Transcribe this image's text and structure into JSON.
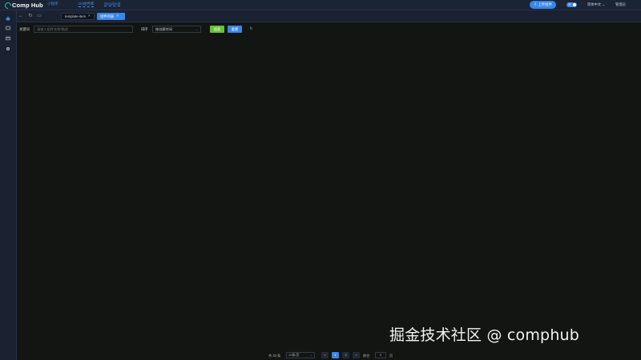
{
  "header": {
    "logo_text": "Comp Hub",
    "links": [
      "小程序",
      "Git组件库",
      "Storybook"
    ],
    "upload_button": "上传组件",
    "toggle_label": "开",
    "language": "简体中文",
    "user": "管理员"
  },
  "sidebar": {
    "icons": [
      "home-icon",
      "component-icon",
      "mail-icon",
      "settings-icon"
    ]
  },
  "tabs": [
    {
      "label": "template-item",
      "active": false
    },
    {
      "label": "组件列表",
      "active": true
    }
  ],
  "filter": {
    "keyword_label": "关键词",
    "keyword_placeholder": "请输入组件名称/描述",
    "sort_label": "排序",
    "sort_value": "按创建时间",
    "search_button": "搜索",
    "reset_button": "重置"
  },
  "pagination": {
    "total": "共 33 条",
    "page_size": "10条/页",
    "pages": [
      "1",
      "2"
    ],
    "current_page": "1",
    "prev": "<",
    "next": ">",
    "goto_label": "前往",
    "goto_value": "1",
    "goto_suffix": "页"
  },
  "watermark": "掘金技术社区 @ comphub",
  "colors": {
    "accent": "#3a86e8",
    "success": "#67c23a",
    "teal_logo": "#19c9b4",
    "background": "#121512",
    "header_bg": "#1b2434"
  }
}
